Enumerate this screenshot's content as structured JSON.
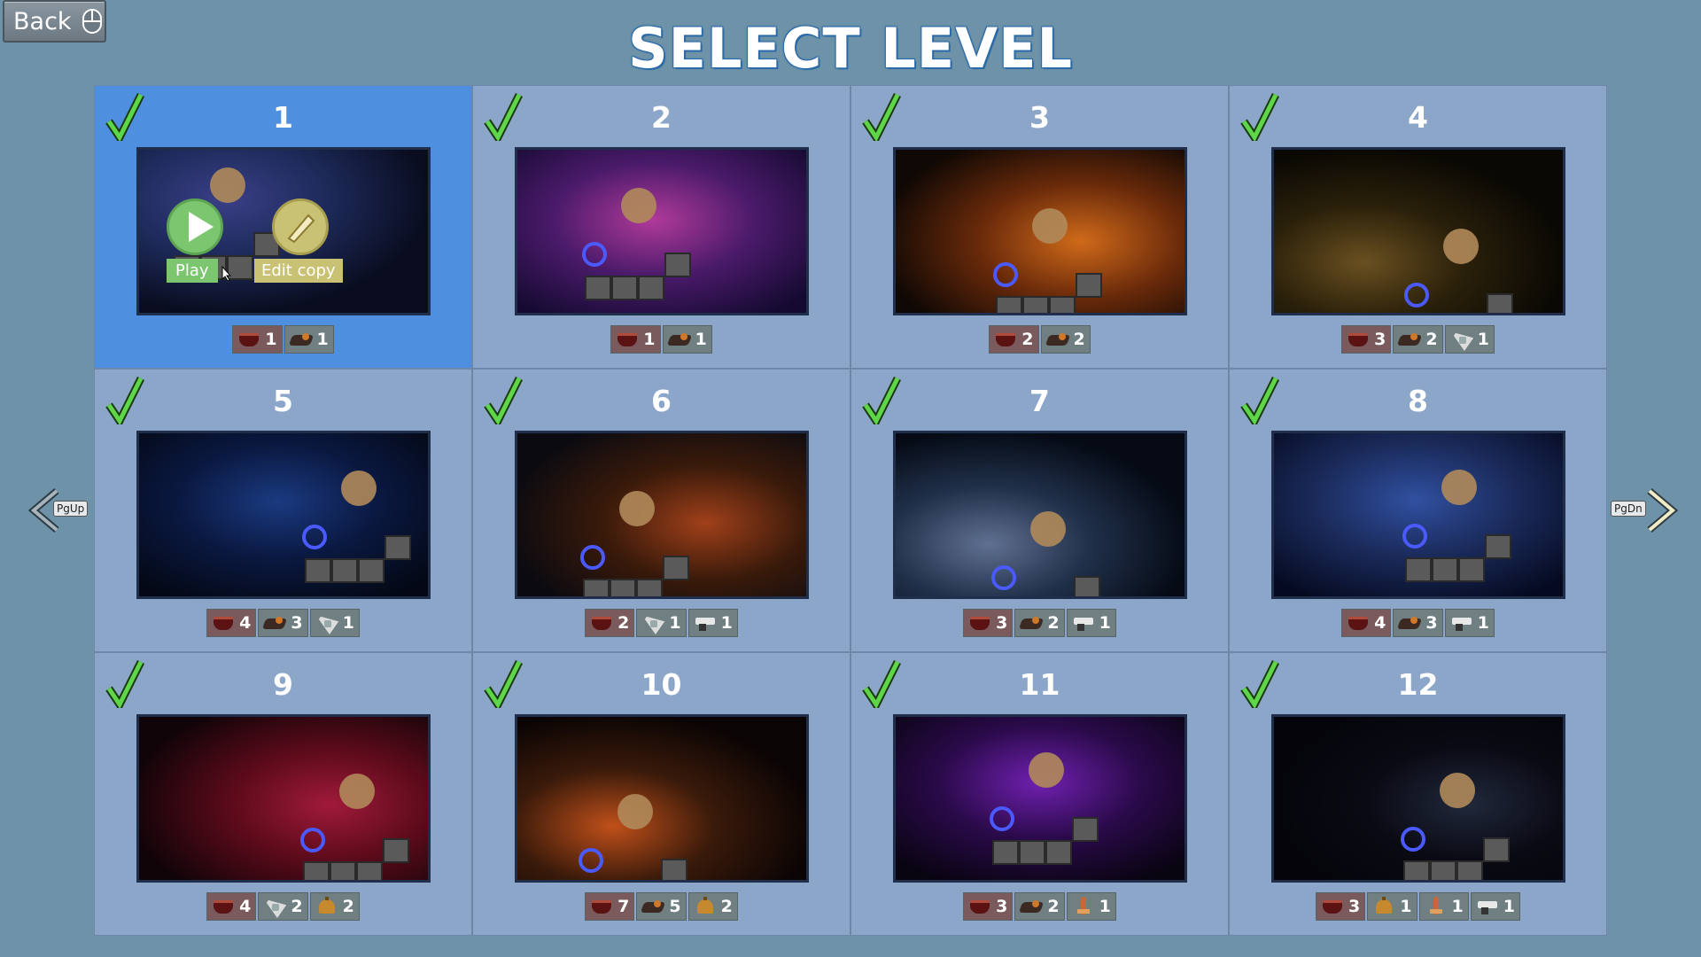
{
  "back_button": {
    "label": "Back"
  },
  "title": "SELECT LEVEL",
  "nav": {
    "prev_key": "PgUp",
    "next_key": "PgDn"
  },
  "popup": {
    "play_label": "Play",
    "edit_label": "Edit copy"
  },
  "colors": {
    "background": "#6e93a8",
    "cell": "#8ba6c9",
    "selected_cell": "#4f8fe0",
    "check": "#5fd64a",
    "title_outline": "#2b6aa8"
  },
  "levels": [
    {
      "number": "1",
      "completed": true,
      "selected": true,
      "stats": [
        {
          "icon": "cup-icon",
          "count": "1"
        },
        {
          "icon": "ship-icon",
          "count": "1"
        }
      ]
    },
    {
      "number": "2",
      "completed": true,
      "stats": [
        {
          "icon": "cup-icon",
          "count": "1"
        },
        {
          "icon": "ship-icon",
          "count": "1"
        }
      ]
    },
    {
      "number": "3",
      "completed": true,
      "stats": [
        {
          "icon": "cup-icon",
          "count": "2"
        },
        {
          "icon": "ship-icon",
          "count": "2"
        }
      ]
    },
    {
      "number": "4",
      "completed": true,
      "stats": [
        {
          "icon": "cup-icon",
          "count": "3"
        },
        {
          "icon": "ship-icon",
          "count": "2"
        },
        {
          "icon": "satellite-icon",
          "count": "1"
        }
      ]
    },
    {
      "number": "5",
      "completed": true,
      "stats": [
        {
          "icon": "cup-icon",
          "count": "4"
        },
        {
          "icon": "ship-icon",
          "count": "3"
        },
        {
          "icon": "satellite-icon",
          "count": "1"
        }
      ]
    },
    {
      "number": "6",
      "completed": true,
      "stats": [
        {
          "icon": "cup-icon",
          "count": "2"
        },
        {
          "icon": "satellite-icon",
          "count": "1"
        },
        {
          "icon": "gun-icon",
          "count": "1"
        }
      ]
    },
    {
      "number": "7",
      "completed": true,
      "stats": [
        {
          "icon": "cup-icon",
          "count": "3"
        },
        {
          "icon": "ship-icon",
          "count": "2"
        },
        {
          "icon": "gun-icon",
          "count": "1"
        }
      ]
    },
    {
      "number": "8",
      "completed": true,
      "stats": [
        {
          "icon": "cup-icon",
          "count": "4"
        },
        {
          "icon": "ship-icon",
          "count": "3"
        },
        {
          "icon": "gun-icon",
          "count": "1"
        }
      ]
    },
    {
      "number": "9",
      "completed": true,
      "stats": [
        {
          "icon": "cup-icon",
          "count": "4"
        },
        {
          "icon": "satellite-icon",
          "count": "2"
        },
        {
          "icon": "bell-icon",
          "count": "2"
        }
      ]
    },
    {
      "number": "10",
      "completed": true,
      "stats": [
        {
          "icon": "cup-icon",
          "count": "7"
        },
        {
          "icon": "ship-icon",
          "count": "5"
        },
        {
          "icon": "bell-icon",
          "count": "2"
        }
      ]
    },
    {
      "number": "11",
      "completed": true,
      "stats": [
        {
          "icon": "cup-icon",
          "count": "3"
        },
        {
          "icon": "ship-icon",
          "count": "2"
        },
        {
          "icon": "rocket-icon",
          "count": "1"
        }
      ]
    },
    {
      "number": "12",
      "completed": true,
      "stats": [
        {
          "icon": "cup-icon",
          "count": "3"
        },
        {
          "icon": "bell-icon",
          "count": "1"
        },
        {
          "icon": "rocket-icon",
          "count": "1"
        },
        {
          "icon": "gun-icon",
          "count": "1"
        }
      ]
    }
  ]
}
